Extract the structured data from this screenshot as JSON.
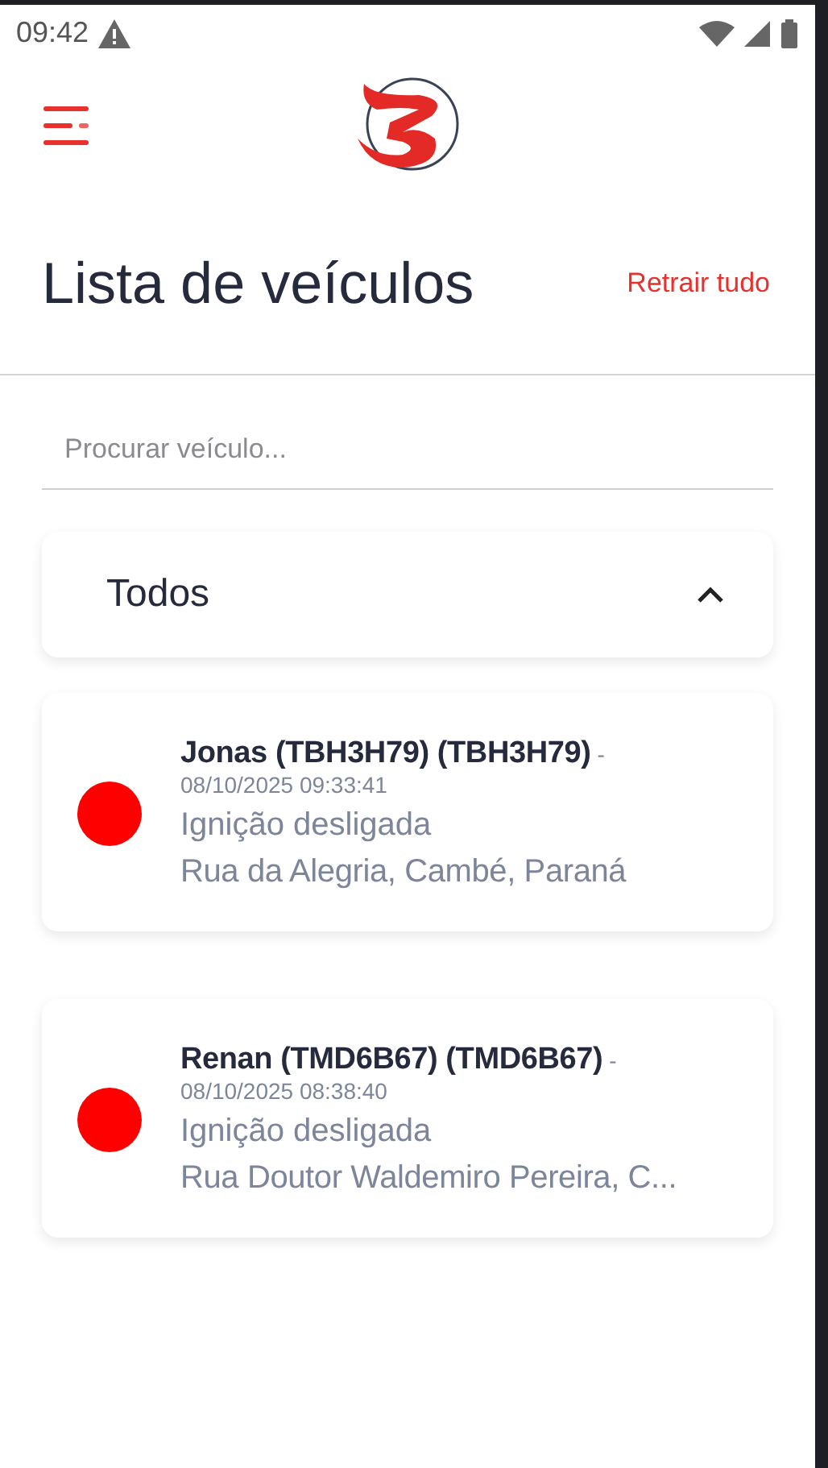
{
  "status_bar": {
    "time": "09:42"
  },
  "header": {
    "title": "Lista de veículos",
    "action": "Retrair tudo"
  },
  "search": {
    "placeholder": "Procurar veículo..."
  },
  "group": {
    "label": "Todos",
    "expanded": true
  },
  "vehicles": [
    {
      "name": "Jonas (TBH3H79) (TBH3H79)",
      "separator": "-",
      "timestamp": "08/10/2025 09:33:41",
      "status": "Ignição desligada",
      "address": "Rua da Alegria, Cambé, Paraná",
      "color": "#ff0000"
    },
    {
      "name": "Renan (TMD6B67) (TMD6B67)",
      "separator": "-",
      "timestamp": "08/10/2025 08:38:40",
      "status": "Ignição desligada",
      "address": "Rua Doutor Waldemiro Pereira, C...",
      "color": "#ff0000"
    }
  ]
}
